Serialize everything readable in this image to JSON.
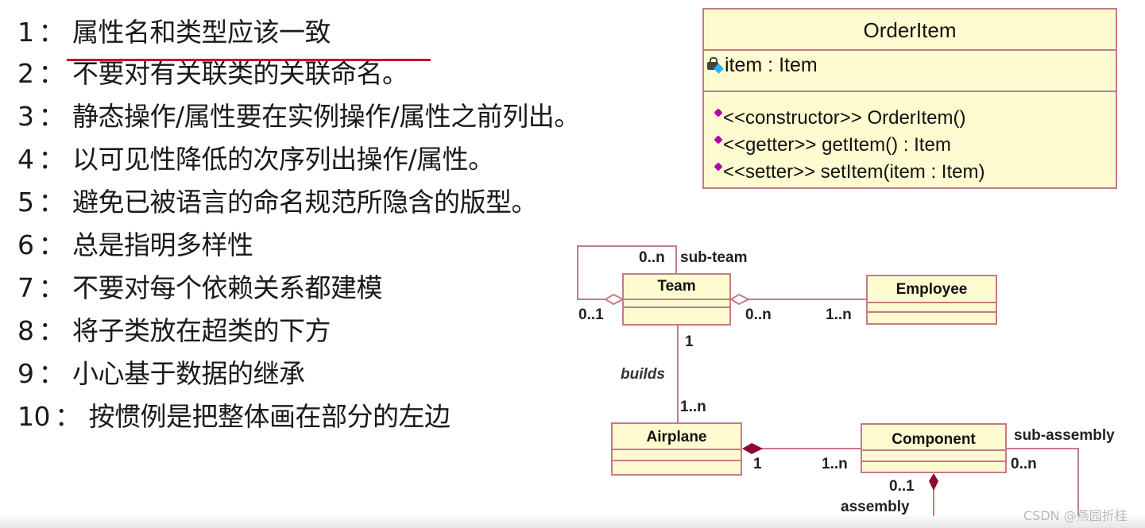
{
  "rules": [
    {
      "num": "1",
      "text": "属性名和类型应该一致"
    },
    {
      "num": "2",
      "text": "不要对有关联类的关联命名。"
    },
    {
      "num": "3",
      "text": "静态操作/属性要在实例操作/属性之前列出。"
    },
    {
      "num": "4",
      "text": "以可见性降低的次序列出操作/属性。"
    },
    {
      "num": "5",
      "text": "避免已被语言的命名规范所隐含的版型。"
    },
    {
      "num": "6",
      "text": "总是指明多样性"
    },
    {
      "num": "7",
      "text": "不要对每个依赖关系都建模"
    },
    {
      "num": "8",
      "text": "将子类放在超类的下方"
    },
    {
      "num": "9",
      "text": "小心基于数据的继承"
    },
    {
      "num": "10",
      "text": "按惯例是把整体画在部分的左边"
    }
  ],
  "separator": "：",
  "orderitem": {
    "name": "OrderItem",
    "attribute": "item : Item",
    "operations": [
      "<<constructor>> OrderItem()",
      "<<getter>> getItem() : Item",
      "<<setter>> setItem(item : Item)"
    ]
  },
  "classes": {
    "team": "Team",
    "employee": "Employee",
    "airplane": "Airplane",
    "component": "Component"
  },
  "labels": {
    "team_self_top": "0..n",
    "sub_team": "sub-team",
    "team_self_bottom": "0..1",
    "team_emp_team": "0..n",
    "team_emp_emp": "1..n",
    "team_builds_top": "1",
    "builds": "builds",
    "builds_airplane": "1..n",
    "airplane_whole": "1",
    "component_part": "1..n",
    "sub_assembly": "sub-assembly",
    "sub_assembly_mult": "0..n",
    "assembly_mult": "0..1",
    "assembly": "assembly"
  },
  "colors": {
    "class_fill": "#fffbd0",
    "class_border": "#c47b86",
    "composition": "#8b0a2e",
    "underline": "#c8102e"
  },
  "watermark": "CSDN @燕园折桂"
}
